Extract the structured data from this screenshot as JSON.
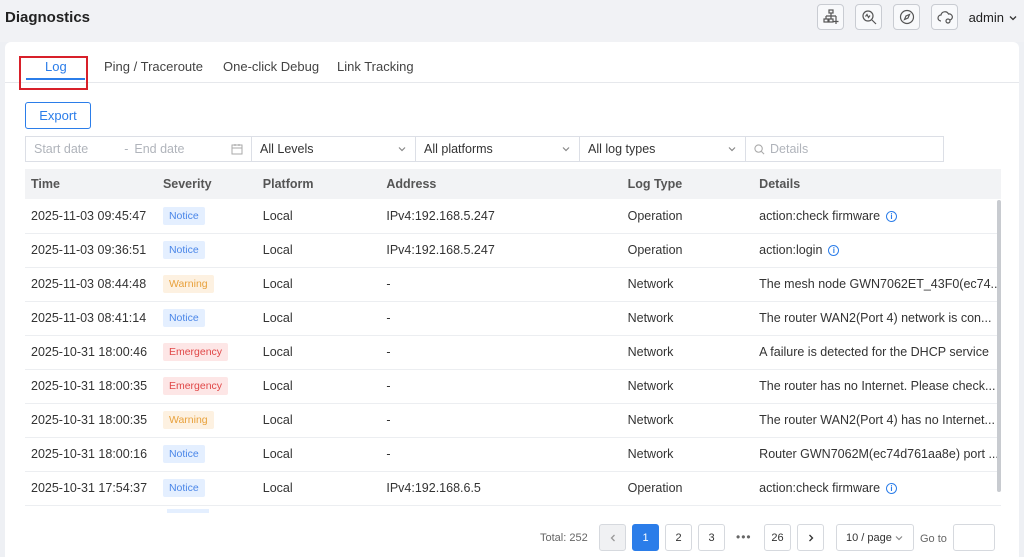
{
  "header": {
    "title": "Diagnostics",
    "user": "admin"
  },
  "tabs": [
    {
      "label": "Log",
      "active": true
    },
    {
      "label": "Ping / Traceroute",
      "active": false
    },
    {
      "label": "One-click Debug",
      "active": false
    },
    {
      "label": "Link Tracking",
      "active": false
    }
  ],
  "toolbar": {
    "export_label": "Export"
  },
  "filters": {
    "start_date_placeholder": "Start date",
    "date_separator": "-",
    "end_date_placeholder": "End date",
    "level": "All Levels",
    "platform": "All platforms",
    "log_type": "All log types",
    "details_placeholder": "Details"
  },
  "table": {
    "columns": [
      "Time",
      "Severity",
      "Platform",
      "Address",
      "Log Type",
      "Details"
    ],
    "rows": [
      {
        "time": "2025-11-03 09:45:47",
        "severity": "Notice",
        "platform": "Local",
        "address": "IPv4:192.168.5.247",
        "log_type": "Operation",
        "details": "action:check firmware",
        "info": true
      },
      {
        "time": "2025-11-03 09:36:51",
        "severity": "Notice",
        "platform": "Local",
        "address": "IPv4:192.168.5.247",
        "log_type": "Operation",
        "details": "action:login",
        "info": true
      },
      {
        "time": "2025-11-03 08:44:48",
        "severity": "Warning",
        "platform": "Local",
        "address": "-",
        "log_type": "Network",
        "details": "The mesh node GWN7062ET_43F0(ec74...",
        "info": false
      },
      {
        "time": "2025-11-03 08:41:14",
        "severity": "Notice",
        "platform": "Local",
        "address": "-",
        "log_type": "Network",
        "details": "The router WAN2(Port 4) network is con...",
        "info": false
      },
      {
        "time": "2025-10-31 18:00:46",
        "severity": "Emergency",
        "platform": "Local",
        "address": "-",
        "log_type": "Network",
        "details": "A failure is detected for the DHCP service",
        "info": false
      },
      {
        "time": "2025-10-31 18:00:35",
        "severity": "Emergency",
        "platform": "Local",
        "address": "-",
        "log_type": "Network",
        "details": "The router has no Internet. Please check...",
        "info": false
      },
      {
        "time": "2025-10-31 18:00:35",
        "severity": "Warning",
        "platform": "Local",
        "address": "-",
        "log_type": "Network",
        "details": "The router WAN2(Port 4) has no Internet...",
        "info": false
      },
      {
        "time": "2025-10-31 18:00:16",
        "severity": "Notice",
        "platform": "Local",
        "address": "-",
        "log_type": "Network",
        "details": "Router GWN7062M(ec74d761aa8e) port ...",
        "info": false
      },
      {
        "time": "2025-10-31 17:54:37",
        "severity": "Notice",
        "platform": "Local",
        "address": "IPv4:192.168.6.5",
        "log_type": "Operation",
        "details": "action:check firmware",
        "info": true
      }
    ],
    "info_glyph": "i"
  },
  "pagination": {
    "total": "Total: 252",
    "pages": [
      "1",
      "2",
      "3"
    ],
    "current": "1",
    "ellipsis": "•••",
    "last": "26",
    "page_size": "10 / page",
    "goto_label": "Go to"
  },
  "colors": {
    "accent": "#2b7de9",
    "highlight": "#d8202a",
    "notice": "#4a86e8",
    "warning": "#e8a13c",
    "emergency": "#e04848"
  },
  "icons": [
    "network-topology-icon",
    "search-diagnose-icon",
    "compass-icon",
    "cloud-settings-icon",
    "chevron-down-icon",
    "calendar-icon",
    "search-icon",
    "info-icon",
    "chevron-left-icon",
    "chevron-right-icon"
  ]
}
